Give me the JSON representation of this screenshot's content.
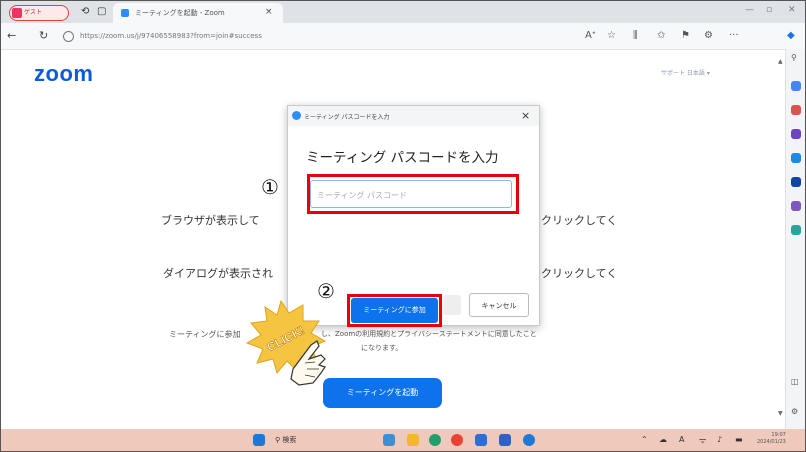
{
  "browser": {
    "profile_label": "ゲスト",
    "tab_title": "ミーティングを起動 - Zoom",
    "tab_close": "×",
    "url": "https://zoom.us/j/97406558983?from=join#success",
    "win_min": "—",
    "win_max": "▫",
    "win_close": "✕"
  },
  "page": {
    "logo": "zoom",
    "top_links": "サポート   日本語 ▾",
    "line1_left": "ブラウザが表示して",
    "line1_right": "クリックしてく",
    "line2_left": "ダイアログが表示され",
    "line2_right": "クリックしてく",
    "line3_left": "ミーティングに参加",
    "line3_mid": "し、Zoomの利用規約とプライバシーステートメントに同意したこと",
    "line3_mid2": "になります。",
    "launch_button": "ミーティングを起動"
  },
  "modal": {
    "window_title": "ミーティング パスコードを入力",
    "close": "×",
    "heading": "ミーティング パスコードを入力",
    "input_placeholder": "ミーティング パスコード",
    "join_button": "ミーティングに参加",
    "cancel_button": "キャンセル"
  },
  "annotations": {
    "step1": "①",
    "step2": "②",
    "click_badge": "CLICK!",
    "highlight_color": "#e8000c"
  },
  "taskbar": {
    "search_label": "検索",
    "time": "19:07",
    "date": "2024/01/23"
  },
  "colors": {
    "zoom_blue": "#0e72ed",
    "taskbar": "#f0c9bd"
  }
}
